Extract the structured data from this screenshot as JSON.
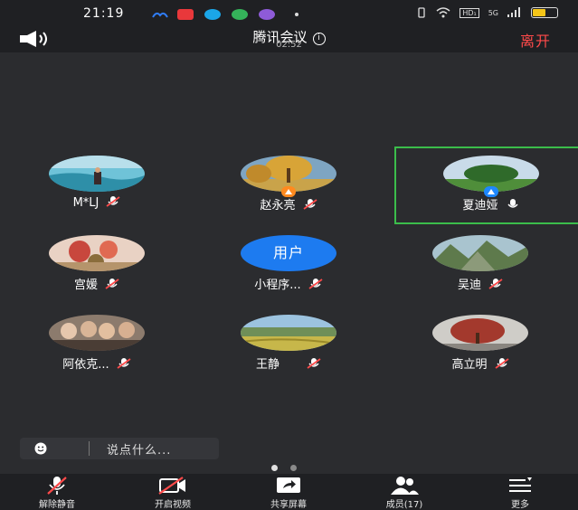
{
  "status_bar": {
    "time": "21:19",
    "network_label": "HD₁",
    "signal_label": "5G",
    "battery_level": 0.55,
    "icons": [
      "baidu-icon",
      "app-icon-red",
      "app-icon-cyan",
      "app-icon-green",
      "app-icon-purple",
      "dot-icon",
      "vibrate-icon",
      "wifi-icon",
      "hd-icon",
      "signal-icon",
      "battery-icon"
    ]
  },
  "header": {
    "title": "腾讯会议",
    "duration": "02:52",
    "leave_label": "离开",
    "speaker_icon": "speaker-icon",
    "info_icon": "info-icon"
  },
  "participants": [
    {
      "name": "M*LJ",
      "muted": true,
      "avatar": "beach-photo",
      "badge": null,
      "active": false
    },
    {
      "name": "赵永亮",
      "muted": true,
      "avatar": "tree-photo",
      "badge": "orange",
      "active": false
    },
    {
      "name": "夏迪娅",
      "muted": false,
      "avatar": "field-photo",
      "badge": "blue",
      "active": true
    },
    {
      "name": "宫媛",
      "muted": true,
      "avatar": "flower-photo",
      "badge": null,
      "active": false
    },
    {
      "name": "小程序...",
      "muted": true,
      "avatar": "用户",
      "badge": null,
      "active": false
    },
    {
      "name": "吴迪",
      "muted": true,
      "avatar": "mountain-photo",
      "badge": null,
      "active": false
    },
    {
      "name": "阿依克...",
      "muted": true,
      "avatar": "group-photo",
      "badge": null,
      "active": false
    },
    {
      "name": "王静",
      "muted": true,
      "avatar": "farmland-photo",
      "badge": null,
      "active": false
    },
    {
      "name": "高立明",
      "muted": true,
      "avatar": "autumn-tree-photo",
      "badge": null,
      "active": false
    }
  ],
  "chat": {
    "placeholder": "说点什么..."
  },
  "pagination": {
    "current": 1,
    "total": 2
  },
  "toolbar": {
    "unmute_label": "解除静音",
    "video_label": "开启视频",
    "share_label": "共享屏幕",
    "members_label": "成员(17)",
    "more_label": "更多"
  },
  "colors": {
    "background": "#2b2c2f",
    "bar": "#1f2023",
    "leave": "#ff4a4a",
    "active_border": "#3bbd4b",
    "user_avatar": "#1d7bf0"
  }
}
